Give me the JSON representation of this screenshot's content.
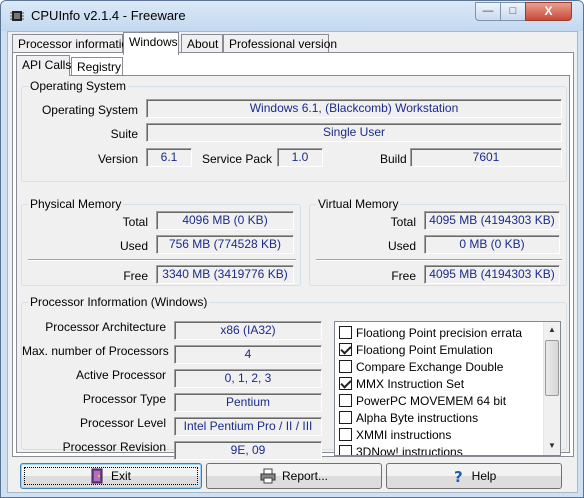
{
  "window": {
    "title": "CPUInfo v2.1.4 - Freeware",
    "controls": [
      "—",
      "□",
      "X"
    ]
  },
  "tabs": [
    "Processor information",
    "Windows",
    "About",
    "Professional version"
  ],
  "subtabs": [
    "API Calls",
    "Registry"
  ],
  "os": {
    "title": "Operating System",
    "labels": {
      "os": "Operating System",
      "suite": "Suite",
      "version": "Version",
      "service_pack": "Service Pack",
      "build": "Build"
    },
    "values": {
      "os": "Windows 6.1, (Blackcomb) Workstation",
      "suite": "Single User",
      "version": "6.1",
      "service_pack": "1.0",
      "build": "7601"
    }
  },
  "physical": {
    "title": "Physical Memory",
    "labels": {
      "total": "Total",
      "used": "Used",
      "free": "Free"
    },
    "values": {
      "total": "4096 MB (0 KB)",
      "used": "756 MB (774528 KB)",
      "free": "3340 MB (3419776 KB)"
    }
  },
  "virtual": {
    "title": "Virtual Memory",
    "labels": {
      "total": "Total",
      "used": "Used",
      "free": "Free"
    },
    "values": {
      "total": "4095 MB (4194303 KB)",
      "used": "0 MB (0 KB)",
      "free": "4095 MB (4194303 KB)"
    }
  },
  "processor": {
    "title": "Processor Information (Windows)",
    "rows": [
      {
        "label": "Processor Architecture",
        "value": "x86 (IA32)"
      },
      {
        "label": "Max. number of Processors",
        "value": "4"
      },
      {
        "label": "Active Processor",
        "value": "0, 1, 2, 3"
      },
      {
        "label": "Processor Type",
        "value": "Pentium"
      },
      {
        "label": "Processor Level",
        "value": "Intel Pentium Pro / II / III"
      },
      {
        "label": "Processor Revision",
        "value": "9E, 09"
      }
    ],
    "features": [
      {
        "label": "Floationg Point precision errata",
        "checked": false
      },
      {
        "label": "Floationg Point Emulation",
        "checked": true
      },
      {
        "label": "Compare Exchange Double",
        "checked": false
      },
      {
        "label": "MMX Instruction Set",
        "checked": true
      },
      {
        "label": "PowerPC MOVEMEM 64 bit",
        "checked": false
      },
      {
        "label": "Alpha Byte instructions",
        "checked": false
      },
      {
        "label": "XMMI instructions",
        "checked": false
      },
      {
        "label": "3DNow! instructions",
        "checked": false
      }
    ]
  },
  "buttons": {
    "exit": "Exit",
    "report": "Report...",
    "help": "Help"
  }
}
